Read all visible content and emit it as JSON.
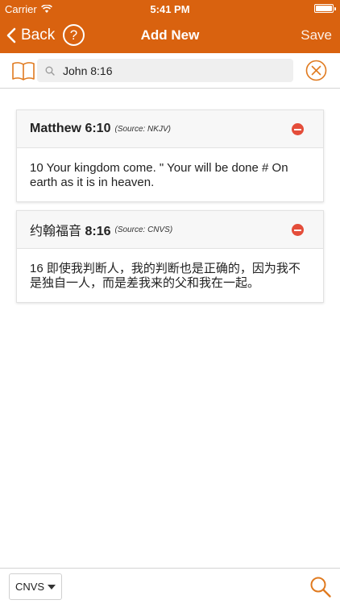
{
  "status_bar": {
    "carrier": "Carrier",
    "time": "5:41 PM"
  },
  "nav": {
    "back_label": "Back",
    "help_label": "?",
    "title": "Add New",
    "save_label": "Save"
  },
  "search": {
    "query": "John 8:16"
  },
  "cards": [
    {
      "book": "Matthew",
      "chapter_verse": "6:10",
      "source": "(Source: NKJV)",
      "text": "10 Your kingdom come. \" Your will be done # On earth as it is in heaven."
    },
    {
      "book": "约翰福音",
      "chapter_verse": "8:16",
      "source": "(Source: CNVS)",
      "text": "16 即使我判断人，我的判断也是正确的，因为我不是独自一人，而是差我来的父和我在一起。"
    }
  ],
  "bottom": {
    "version": "CNVS"
  },
  "colors": {
    "accent": "#d9620f",
    "remove": "#e44d3a",
    "icon_orange": "#e07a1f"
  },
  "icons": [
    "chevron-left-icon",
    "question-icon",
    "book-icon",
    "search-icon",
    "close-circle-icon",
    "minus-circle-icon",
    "caret-down-icon",
    "magnifier-icon"
  ]
}
